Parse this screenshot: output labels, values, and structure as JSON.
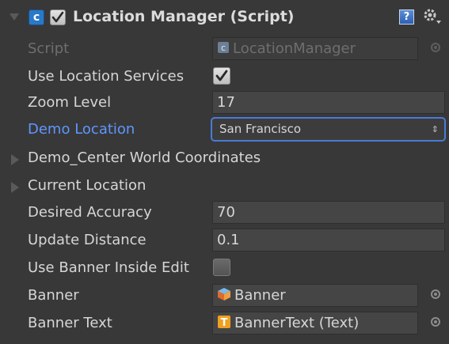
{
  "component": {
    "title": "Location Manager (Script)",
    "enabled": true,
    "icons": [
      "foldout-arrow-icon",
      "script-icon",
      "help-icon",
      "gear-icon"
    ]
  },
  "rows": {
    "script": {
      "label": "Script",
      "value": "LocationManager",
      "icon": "script-asset-icon"
    },
    "use_location_services": {
      "label": "Use Location Services",
      "checked": true
    },
    "zoom_level": {
      "label": "Zoom Level",
      "value": "17"
    },
    "demo_location": {
      "label": "Demo Location",
      "value": "San Francisco",
      "arrows": "⇕"
    },
    "demo_center": {
      "label": "Demo_Center World Coordinates",
      "expanded": false
    },
    "current_location": {
      "label": "Current Location",
      "expanded": false
    },
    "desired_accuracy": {
      "label": "Desired Accuracy",
      "value": "70"
    },
    "update_distance": {
      "label": "Update Distance",
      "value": "0.1"
    },
    "use_banner": {
      "label": "Use Banner Inside Edit",
      "checked": false
    },
    "banner": {
      "label": "Banner",
      "value": "Banner",
      "icon": "gameobject-cube-icon"
    },
    "banner_text": {
      "label": "Banner Text",
      "value": "BannerText (Text)",
      "icon": "text-component-icon"
    }
  },
  "colors": {
    "background": "#383838",
    "field_bg": "#454545",
    "label": "#d6d6d6",
    "focused_label": "#5f96ff",
    "focus_border": "#4a7bd6"
  }
}
